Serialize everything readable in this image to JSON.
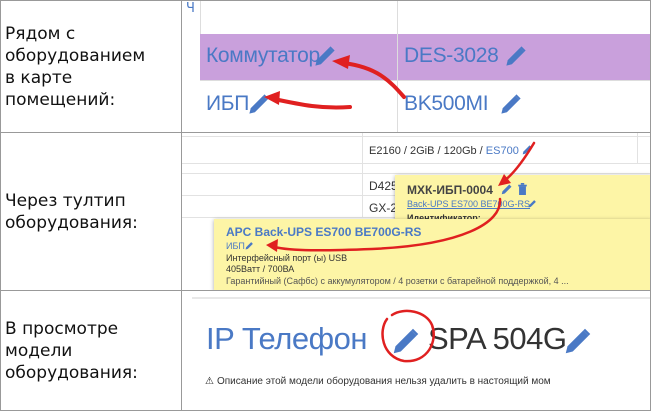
{
  "rows": [
    {
      "label": "Рядом с\nоборудованием\nв карте\nпомещений:",
      "shot": {
        "header_char": "Ч",
        "cells": [
          "Коммутатор",
          "DES-3028",
          "ИБП",
          "BK500MI"
        ],
        "highlight_color": "#c9a0dc"
      }
    },
    {
      "label": "Через тултип\nоборудования:",
      "shot": {
        "specs_prefix": "E2160 / 2GiB / 120Gb / ",
        "specs_link": "ES700",
        "row_texts": [
          "D425",
          "GX-21"
        ],
        "tooltip_small": {
          "title": "МХК-ИБП-0004",
          "model": "Back-UPS ES700 BE700G-RS",
          "field": "Идентификатор:"
        },
        "tooltip_large": {
          "title": "APC Back-UPS ES700 BE700G-RS",
          "type": "ИБП",
          "line1": "Интерфейсный порт (ы) USB",
          "line2": "405Ватт / 700ВА",
          "line3": "Гарантийный (Сафбс) с аккумулятором / 4 розетки с батарейной поддержкой, 4 ..."
        },
        "tooltip_color": "#fdf5a6"
      }
    },
    {
      "label": "В просмотре\nмодели\nоборудования:",
      "shot": {
        "title_type": "IP Телефон",
        "title_model": "SPA 504G",
        "warning": "Описание этой модели оборудования нельзя удалить в настоящий мом"
      }
    }
  ],
  "colors": {
    "link": "#4a79c5",
    "annotation": "#e02020",
    "border": "#999999"
  },
  "icons": [
    "pencil-icon",
    "trash-icon",
    "warning-icon"
  ]
}
